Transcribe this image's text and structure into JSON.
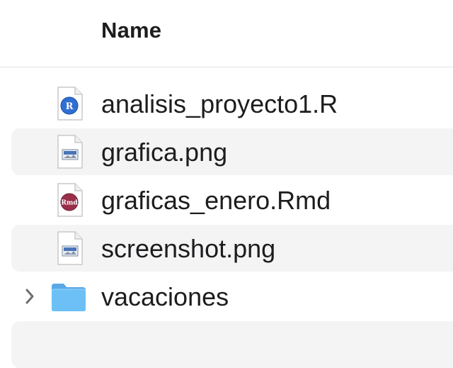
{
  "header": {
    "column_name": "Name"
  },
  "files": [
    {
      "name": "analisis_proyecto1.R",
      "icon": "r-script-icon",
      "badge": "R",
      "badge_color": "#2f6fd2"
    },
    {
      "name": "grafica.png",
      "icon": "png-image-icon"
    },
    {
      "name": "graficas_enero.Rmd",
      "icon": "rmarkdown-icon",
      "badge": "Rmd",
      "badge_color": "#9a2f4a"
    },
    {
      "name": "screenshot.png",
      "icon": "png-image-icon"
    },
    {
      "name": "vacaciones",
      "icon": "folder-icon",
      "is_folder": true,
      "folder_color": "#5ab4f0"
    }
  ]
}
